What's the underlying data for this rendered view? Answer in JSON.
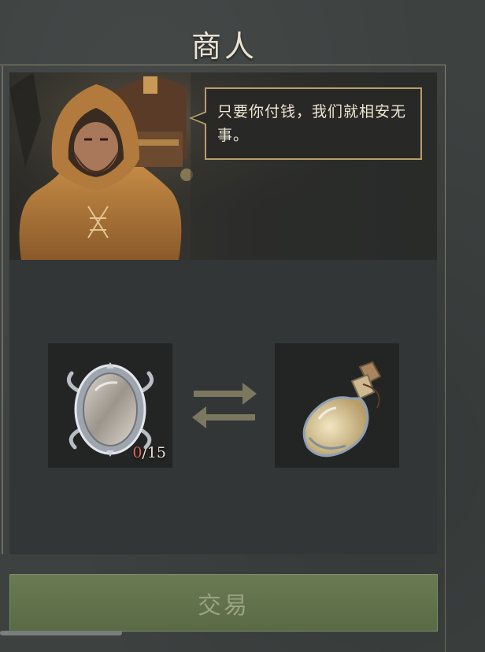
{
  "header": {
    "title": "商人"
  },
  "merchant": {
    "speech": "只要你付钱，我们就相安无事。"
  },
  "trade": {
    "give_item": {
      "icon": "mirror-icon",
      "count_current": "0",
      "count_required": "/15"
    },
    "receive_item": {
      "icon": "potion-bottle-icon"
    },
    "exchange_icon": "exchange-arrows-icon"
  },
  "actions": {
    "trade_label": "交易"
  },
  "colors": {
    "accent_gold": "#b89f6a",
    "count_red": "#e06a5a",
    "button_green": "#6a7a52"
  }
}
